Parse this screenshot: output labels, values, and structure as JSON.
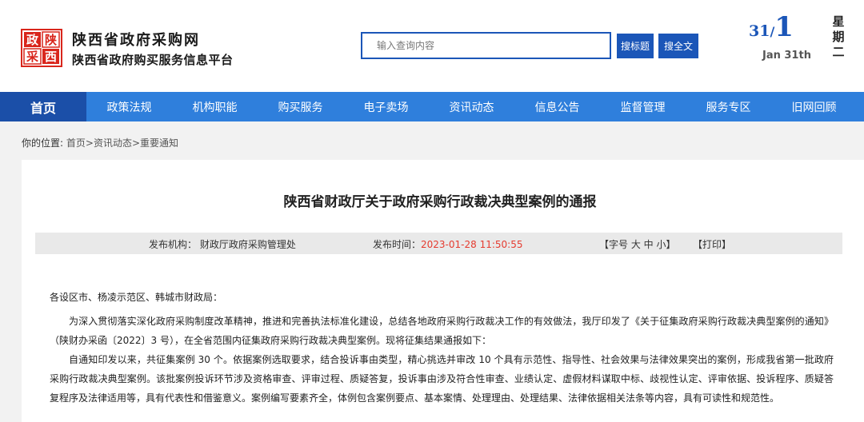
{
  "header": {
    "site_title": "陕西省政府采购网",
    "site_subtitle": "陕西省政府购买服务信息平台",
    "logo": {
      "text": "政陕采西",
      "color": "#d9261c"
    },
    "search": {
      "placeholder": "输入查询内容",
      "btn_title": "搜标题",
      "btn_full": "搜全文"
    },
    "date": {
      "day": "31",
      "sep": "/",
      "month": "1",
      "en": "Jan 31th",
      "weekday": "星期二"
    }
  },
  "nav": {
    "items": [
      "首页",
      "政策法规",
      "机构职能",
      "购买服务",
      "电子卖场",
      "资讯动态",
      "信息公告",
      "监督管理",
      "服务专区",
      "旧网回顾"
    ]
  },
  "breadcrumb": {
    "label": "你的位置:",
    "home": "首页",
    "section": ">资讯动态",
    "page": ">重要通知"
  },
  "article": {
    "title": "陕西省财政厅关于政府采购行政裁决典型案例的通报",
    "meta": {
      "agency_label": "发布机构：",
      "agency_value": "财政厅政府采购管理处",
      "time_label": "发布时间：",
      "time_value": "2023-01-28 11:50:55",
      "font_size": "【字号 大 中 小】",
      "print": "【打印】"
    },
    "salutation": "各设区市、杨凌示范区、韩城市财政局：",
    "paragraphs": [
      "为深入贯彻落实深化政府采购制度改革精神，推进和完善执法标准化建设，总结各地政府采购行政裁决工作的有效做法，我厅印发了《关于征集政府采购行政裁决典型案例的通知》（陕财办采函〔2022〕3 号），在全省范围内征集政府采购行政裁决典型案例。现将征集结果通报如下：",
      "自通知印发以来，共征集案例 30 个。依据案例选取要求，结合投诉事由类型，精心挑选并审改 10 个具有示范性、指导性、社会效果与法律效果突出的案例，形成我省第一批政府采购行政裁决典型案例。该批案例投诉环节涉及资格审查、评审过程、质疑答复，投诉事由涉及符合性审查、业绩认定、虚假材料谋取中标、歧视性认定、评审依据、投诉程序、质疑答复程序及法律适用等，具有代表性和借鉴意义。案例编写要素齐全，体例包含案例要点、基本案情、处理理由、处理结果、法律依据相关法条等内容，具有可读性和规范性。"
    ]
  }
}
